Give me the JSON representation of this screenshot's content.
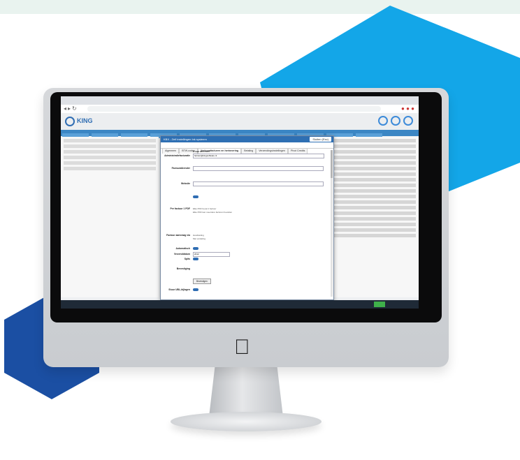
{
  "decor": {
    "hex_large_color": "#13a6e8",
    "hex_small_color": "#1b4fa3",
    "band_color": "#e9f3ef"
  },
  "app": {
    "logo_text": "KING",
    "head_icons": [
      "help-icon",
      "question-icon",
      "power-icon"
    ]
  },
  "dialog": {
    "title": "KBX - Zelf instellingen Ink systeem",
    "close_label": "Sluiten (Esc)",
    "tabs": [
      "Algemeen",
      "BTW-codes",
      "Verkoopfacturen en herinnering",
      "Betaling",
      "Verzendingsinstellingen",
      "Pivot Credits"
    ],
    "active_tab": 2,
    "fields": {
      "administratie_email_label": "Administratiefacturatie",
      "administratie_email_value": "factuur@kingsoftware.nl",
      "e_mail_adressen_label": "E-mail adressen",
      "factuurafzender_label": "Factuurafzender",
      "website_label": "Website",
      "pdf_label": "Per factuur 1 PDF",
      "radio_option_1": "Elke PDF bevat 1 factuur",
      "radio_option_2": "Elke PDF kan meerdere facturen bevatten",
      "factuur_aanvraag_label": "Factuur aanvraag via",
      "factuur_aanvraag_option_1": "Handleiding",
      "factuur_aanvraag_option_2": "Met verdeling",
      "automatisch_label": "Automatisch",
      "verzenddatum_label": "Verzenddatum",
      "verzenddatum_value": "2012",
      "spits_label": "Spits",
      "bevestiging_label": "Bevestiging",
      "button_label": "Bevestigen",
      "ubl_label": "Stuur UBL-bijlagen"
    }
  }
}
